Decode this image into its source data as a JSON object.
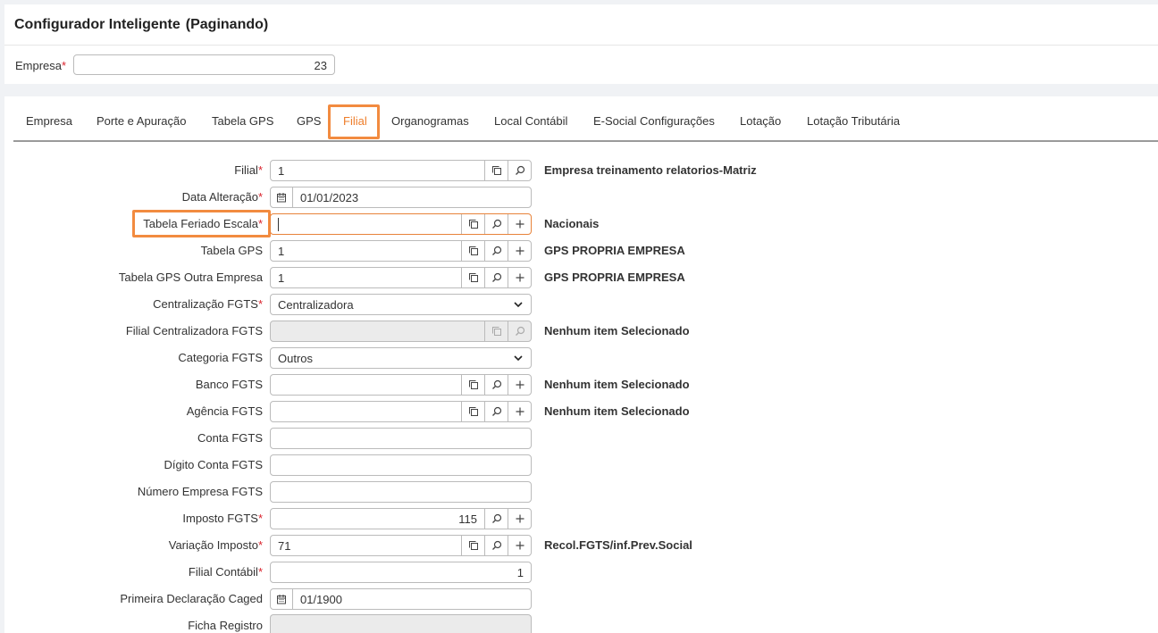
{
  "header": {
    "title": "Configurador Inteligente",
    "subtitle": "(Paginando)",
    "empresa_label": "Empresa",
    "required_mark": "*",
    "empresa_value": "23"
  },
  "tabs": [
    {
      "label": "Empresa"
    },
    {
      "label": "Porte e Apuração"
    },
    {
      "label": "Tabela GPS"
    },
    {
      "label": "GPS"
    },
    {
      "label": "Filial",
      "active": true
    },
    {
      "label": "Organogramas"
    },
    {
      "label": "Local Contábil"
    },
    {
      "label": "E-Social Configurações"
    },
    {
      "label": "Lotação"
    },
    {
      "label": "Lotação Tributária"
    }
  ],
  "form": {
    "filial": {
      "label": "Filial",
      "value": "1",
      "description": "Empresa treinamento relatorios-Matriz"
    },
    "data_alteracao": {
      "label": "Data Alteração",
      "value": "01/01/2023"
    },
    "tabela_feriado": {
      "label": "Tabela Feriado Escala",
      "value": "",
      "description": "Nacionais"
    },
    "tabela_gps": {
      "label": "Tabela GPS",
      "value": "1",
      "description": "GPS PROPRIA EMPRESA"
    },
    "tabela_gps_outra": {
      "label": "Tabela GPS Outra Empresa",
      "value": "1",
      "description": "GPS PROPRIA EMPRESA"
    },
    "centralizacao": {
      "label": "Centralização FGTS",
      "value": "Centralizadora"
    },
    "filial_centralizadora": {
      "label": "Filial Centralizadora FGTS",
      "value": "",
      "description": "Nenhum item Selecionado"
    },
    "categoria": {
      "label": "Categoria FGTS",
      "value": "Outros"
    },
    "banco": {
      "label": "Banco FGTS",
      "value": "",
      "description": "Nenhum item Selecionado"
    },
    "agencia": {
      "label": "Agência FGTS",
      "value": "",
      "description": "Nenhum item Selecionado"
    },
    "conta": {
      "label": "Conta FGTS",
      "value": ""
    },
    "digito": {
      "label": "Dígito Conta FGTS",
      "value": ""
    },
    "numero_empresa": {
      "label": "Número Empresa FGTS",
      "value": ""
    },
    "imposto": {
      "label": "Imposto FGTS",
      "value": "115"
    },
    "variacao": {
      "label": "Variação Imposto",
      "value": "71",
      "description": "Recol.FGTS/inf.Prev.Social"
    },
    "filial_contabil": {
      "label": "Filial Contábil",
      "value": "1"
    },
    "primeira_caged": {
      "label": "Primeira Declaração Caged",
      "value": "01/1900"
    },
    "ficha_registro": {
      "label": "Ficha Registro",
      "value": ""
    }
  },
  "icons": {
    "copy": "copy-icon",
    "search": "search-icon",
    "add": "plus-icon",
    "calendar": "calendar-icon",
    "chevron": "chevron-down-icon"
  },
  "colors": {
    "accent": "#ee7d2a",
    "required": "#d9232d",
    "highlight_border": "#f28b40"
  }
}
